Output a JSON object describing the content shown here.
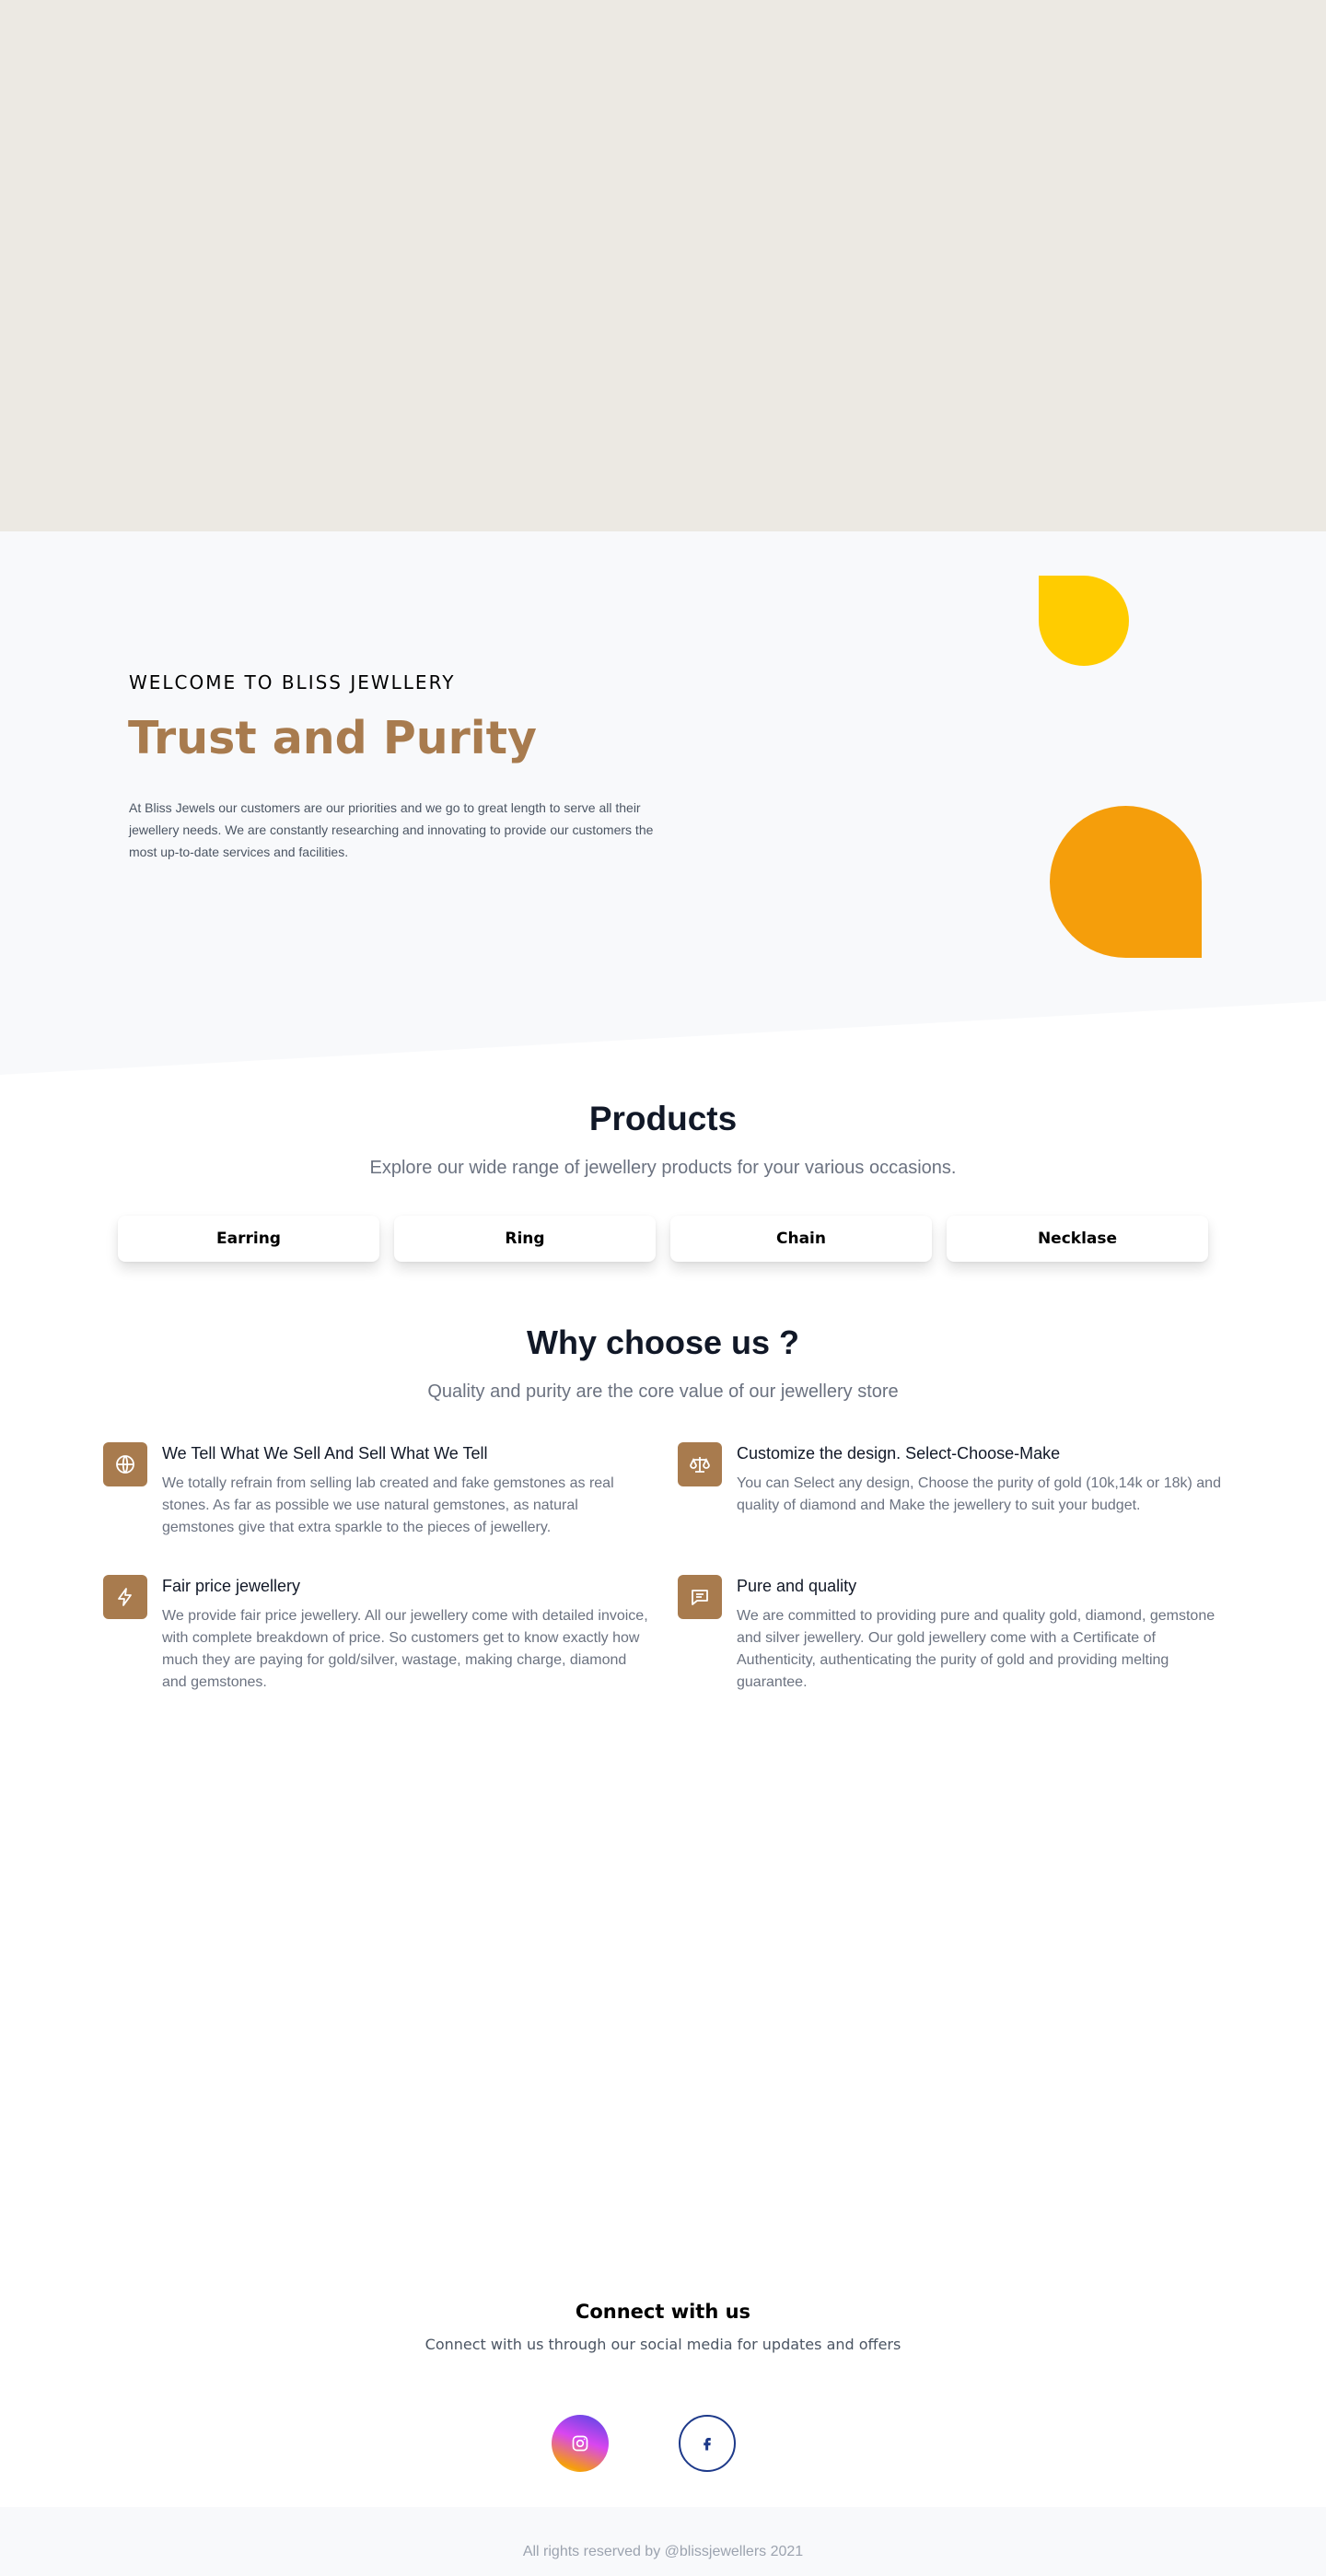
{
  "intro": {
    "eyebrow": "WELCOME TO BLISS JEWLLERY",
    "title": "Trust and Purity",
    "text": "At Bliss Jewels our customers are our priorities and we go to great length to serve all their jewellery needs. We are constantly researching and innovating to provide our customers the most up-to-date services and facilities."
  },
  "products": {
    "title": "Products",
    "subtitle": "Explore our wide range of jewellery products for your various occasions.",
    "items": [
      {
        "label": "Earring"
      },
      {
        "label": "Ring"
      },
      {
        "label": "Chain"
      },
      {
        "label": "Necklase"
      }
    ]
  },
  "why": {
    "title": "Why choose us ?",
    "subtitle": "Quality and purity are the core value of our jewellery store",
    "features": [
      {
        "icon": "globe-icon",
        "title": "We Tell What We Sell And Sell What We Tell",
        "text": "We totally refrain from selling lab created and fake gemstones as real stones. As far as possible we use natural gemstones, as natural gemstones give that extra sparkle to the pieces of jewellery."
      },
      {
        "icon": "scale-icon",
        "title": "Customize the design. Select-Choose-Make",
        "text": "You can Select any design, Choose the purity of gold (10k,14k or 18k) and quality of diamond and Make the jewellery to suit your budget."
      },
      {
        "icon": "lightning-icon",
        "title": "Fair price jewellery",
        "text": "We provide fair price jewellery. All our jewellery come with detailed invoice, with complete breakdown of price. So customers get to know exactly how much they are paying for gold/silver, wastage, making charge, diamond and gemstones."
      },
      {
        "icon": "chat-icon",
        "title": "Pure and quality",
        "text": "We are committed to providing pure and quality gold, diamond, gemstone and silver jewellery. Our gold jewellery come with a Certificate of Authenticity, authenticating the purity of gold and providing melting guarantee."
      }
    ]
  },
  "connect": {
    "title": "Connect with us",
    "subtitle": "Connect with us through our social media for updates and offers",
    "socials": [
      {
        "icon": "instagram-icon"
      },
      {
        "icon": "facebook-icon"
      }
    ]
  },
  "footer": {
    "text": "All rights reserved by @blissjewellers 2021"
  },
  "colors": {
    "accent": "#a87b4e",
    "yellow": "#ffcc00",
    "orange": "#f59e0b",
    "facebook": "#1e3a8a"
  }
}
